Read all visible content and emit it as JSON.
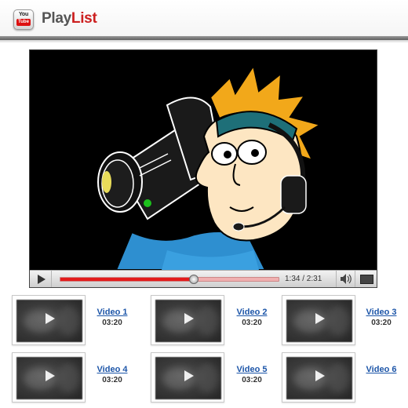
{
  "app": {
    "logo_icon": "youtube-logo-icon",
    "logo_top": "You",
    "logo_bottom": "Tube",
    "title_part1": "Play",
    "title_part2": "List",
    "accent_color": "#cc1f1f"
  },
  "player": {
    "progress_fraction": 0.61,
    "time_display": "1:34 / 2:31",
    "play_icon": "play-icon",
    "volume_icon": "volume-icon",
    "fullscreen_icon": "fullscreen-icon"
  },
  "playlist": [
    {
      "label": "Video 1",
      "duration": "03:20"
    },
    {
      "label": "Video 2",
      "duration": "03:20"
    },
    {
      "label": "Video 3",
      "duration": "03:20"
    },
    {
      "label": "Video 4",
      "duration": "03:20"
    },
    {
      "label": "Video 5",
      "duration": "03:20"
    },
    {
      "label": "Video 6",
      "duration": ""
    }
  ]
}
